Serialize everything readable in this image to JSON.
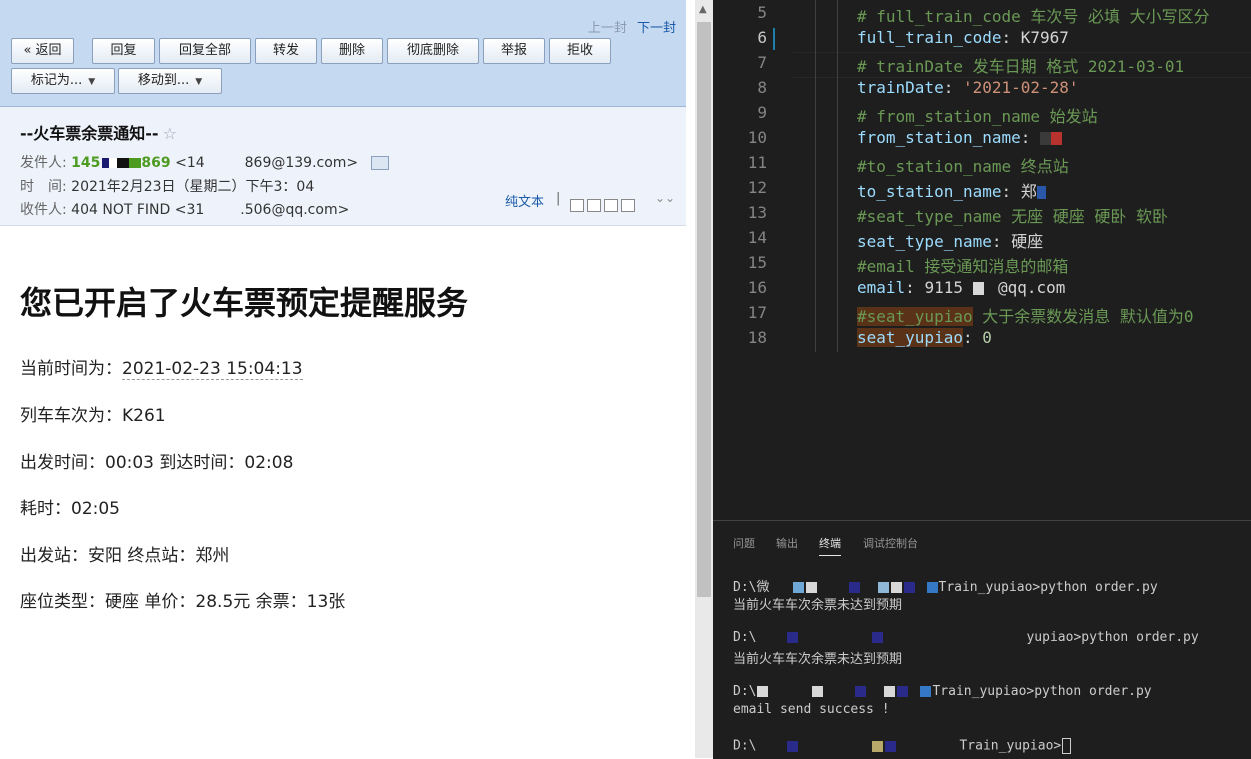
{
  "mail": {
    "nav": {
      "prev": "上一封",
      "next": "下一封"
    },
    "toolbar": {
      "back": "« 返回",
      "reply": "回复",
      "reply_all": "回复全部",
      "forward": "转发",
      "delete": "删除",
      "delete_forever": "彻底删除",
      "report": "举报",
      "reject": "拒收",
      "mark_as": "标记为...",
      "move_to": "移动到..."
    },
    "header": {
      "subject": "--火车票余票通知--",
      "from_label": "发件人:",
      "from_name_a": "145",
      "from_name_b": "869",
      "from_addr_a": "<14",
      "from_addr_b": "869@139.com>",
      "time_label": "时　间:",
      "time_value": "2021年2月23日（星期二）下午3：04",
      "to_label": "收件人:",
      "to_name": "404 NOT FIND",
      "to_addr_a": "<31",
      "to_addr_b": ".506@qq.com>",
      "plain_text": "纯文本",
      "separator": "|"
    },
    "body": {
      "title": "您已开启了火车票预定提醒服务",
      "current_time_label": "当前时间为：",
      "current_time_value": "2021-02-23 15:04:13",
      "train_line": "列车车次为：K261",
      "depart_line": "出发时间：00:03 到达时间：02:08",
      "duration_line": "耗时：02:05",
      "station_line": "出发站：安阳 终点站：郑州",
      "seat_line": "座位类型：硬座 单价：28.5元 余票：13张"
    }
  },
  "editor": {
    "line_numbers": [
      "5",
      "6",
      "7",
      "8",
      "9",
      "10",
      "11",
      "12",
      "13",
      "14",
      "15",
      "16",
      "17",
      "18"
    ],
    "l5": "# full_train_code 车次号 必填 大小写区分",
    "l6_key": "full_train_code",
    "l6_val": "K7967",
    "l7": "# trainDate 发车日期 格式 2021-03-01",
    "l8_key": "trainDate",
    "l8_val": "'2021-02-28'",
    "l9": "# from_station_name 始发站",
    "l10_key": "from_station_name",
    "l11": "#to_station_name 终点站",
    "l12_key": "to_station_name",
    "l12_val": "郑",
    "l13": "#seat_type_name 无座 硬座 硬卧 软卧",
    "l14_key": "seat_type_name",
    "l14_val": "硬座",
    "l15": "#email 接受通知消息的邮箱",
    "l16_key": "email",
    "l16_val_a": "9115",
    "l16_val_b": "@qq.com",
    "l17_hl": "#seat_yupiao",
    "l17_rest": " 大于余票数发消息 默认值为0",
    "l18_key": "seat_yupiao",
    "l18_val": "0",
    "colon": ": "
  },
  "terminal": {
    "tabs": [
      "问题",
      "输出",
      "终端",
      "调试控制台"
    ],
    "prompt_drive": "D:\\",
    "prompt_first_char": "微",
    "prompt_tail": "Train_yupiao>",
    "tail_partial": "yupiao>",
    "command": "python order.py",
    "msg_not_reached": "当前火车车次余票未达到预期",
    "msg_sent": "email send success !",
    "colors": {
      "bg": "#1e1e1e",
      "text": "#cccccc"
    }
  },
  "colors": {
    "mail_toolbar_bg": "#c5d9f1",
    "mail_header_bg": "#eef3fb",
    "sender_green": "#4d9b20",
    "link_blue": "#1a5aa8",
    "editor_bg": "#1e1e1e",
    "comment_green": "#6a9955",
    "key_blue": "#9cdcfe",
    "string_orange": "#ce9178",
    "number_green": "#b5cea8"
  }
}
